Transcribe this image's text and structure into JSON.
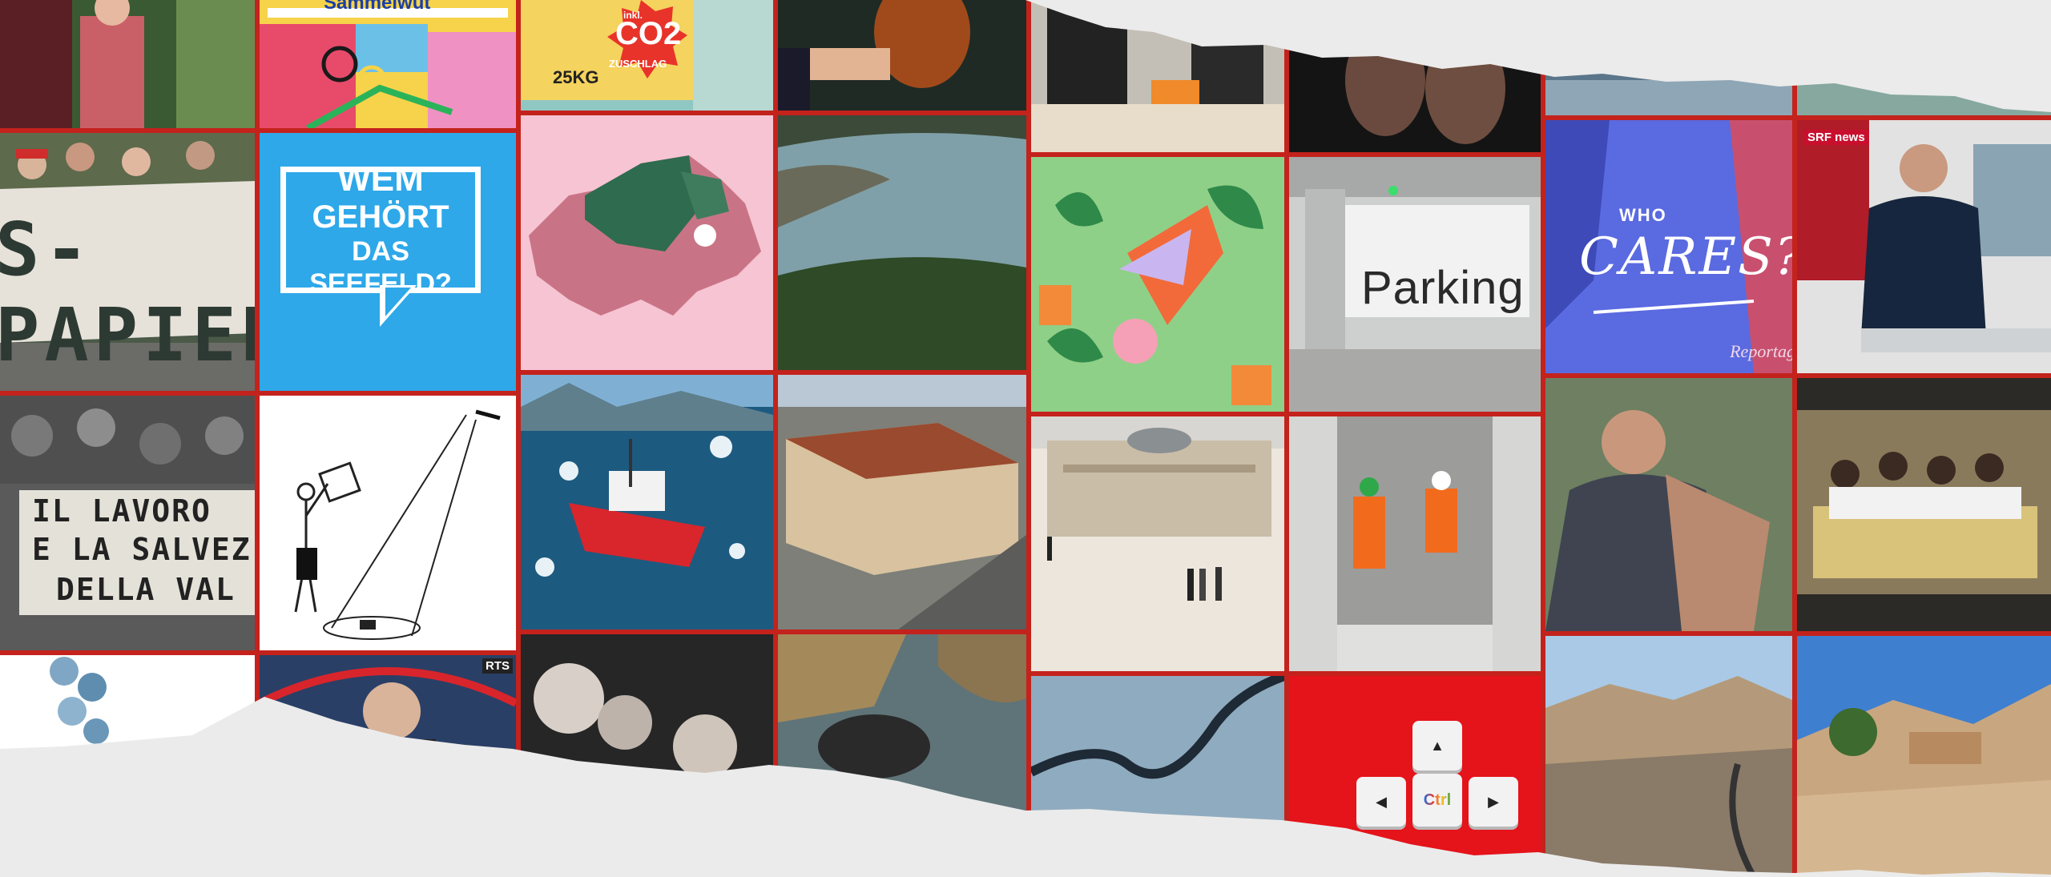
{
  "page": {
    "background": "#ebebeb",
    "grid_color": "#c4221c"
  },
  "tiles": {
    "sammelwut": {
      "text": "Sammelwut"
    },
    "co2": {
      "line1": "inkl.",
      "line2": "CO2",
      "line3": "ZUSCHLAG",
      "weight": "25KG"
    },
    "wem": {
      "line1a": "WEM",
      "line1b": "GEHÖRT",
      "line2": "DAS SEEFELD?"
    },
    "protest": {
      "banner": "S-PAPIER"
    },
    "lavoro": {
      "line1": "IL LAVORO",
      "line2": "E LA SALVEZ",
      "line3": "DELLA VAL"
    },
    "parking": {
      "sign": "Parking"
    },
    "who": {
      "small": "WHO",
      "big": "CARES?",
      "sub": "Reportag"
    },
    "srf": {
      "badge": "SRF news"
    },
    "rts": {
      "badge": "RTS"
    },
    "ctrl": {
      "center": "Ctrl",
      "up": "▲",
      "left": "◀",
      "right": "▶"
    }
  }
}
